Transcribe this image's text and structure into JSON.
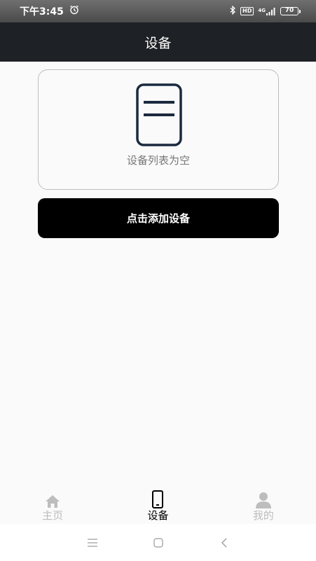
{
  "status_bar": {
    "time": "下午3:45",
    "network": "4G",
    "hd": "HD",
    "battery": "70"
  },
  "header": {
    "title": "设备"
  },
  "device_list": {
    "empty_text": "设备列表为空",
    "icon": "device-card-icon"
  },
  "add_button": {
    "label": "点击添加设备"
  },
  "tabs": [
    {
      "label": "主页",
      "icon": "home-icon",
      "active": false
    },
    {
      "label": "设备",
      "icon": "phone-icon",
      "active": true
    },
    {
      "label": "我的",
      "icon": "user-icon",
      "active": false
    }
  ],
  "nav_bar": {
    "icons": [
      "menu-icon",
      "home-square-icon",
      "back-icon"
    ]
  },
  "colors": {
    "header_bg": "#1e2125",
    "button_bg": "#000000",
    "tab_inactive": "#bdbdbd",
    "tab_active": "#000000"
  }
}
